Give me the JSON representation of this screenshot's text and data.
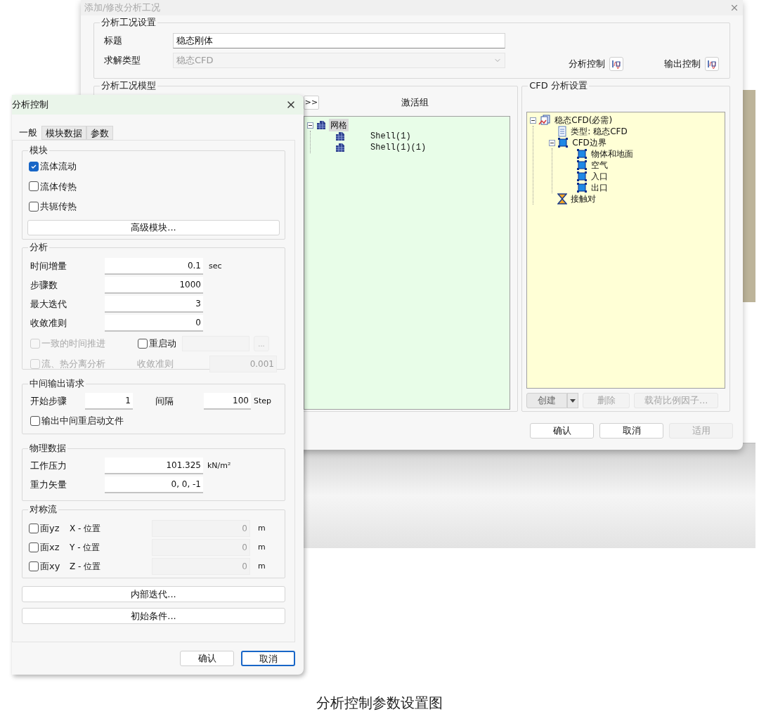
{
  "main_window": {
    "title": "添加/修改分析工况",
    "case_settings": {
      "legend": "分析工况设置",
      "title_field": {
        "label": "标题",
        "value": "稳态刚体"
      },
      "solver_field": {
        "label": "求解类型",
        "value": "稳态CFD",
        "disabled": true
      },
      "controls": [
        "分析控制",
        "输出控制"
      ]
    },
    "case_model": {
      "legend": "分析工况模型",
      "expand_button": ">>",
      "header": "激活组",
      "tree": [
        {
          "label": "网格",
          "kind": "mesh",
          "expanded": true,
          "selected": true,
          "children": [
            {
              "label": "Shell(1)",
              "kind": "mesh",
              "selected": false
            },
            {
              "label": "Shell(1)(1)",
              "kind": "mesh",
              "selected": false
            }
          ]
        }
      ]
    },
    "cfd_settings": {
      "legend": "CFD 分析设置",
      "tree": [
        {
          "label": "稳态CFD(必需)",
          "kind": "analysis",
          "expanded": true,
          "selected": false,
          "children": [
            {
              "label": "类型: 稳态CFD",
              "kind": "document",
              "selected": false
            },
            {
              "label": "CFD边界",
              "kind": "boundary",
              "expanded": true,
              "selected": false,
              "children": [
                {
                  "label": "物体和地面",
                  "kind": "boundary",
                  "selected": false
                },
                {
                  "label": "空气",
                  "kind": "boundary",
                  "selected": false
                },
                {
                  "label": "入口",
                  "kind": "boundary",
                  "selected": false
                },
                {
                  "label": "出口",
                  "kind": "boundary",
                  "selected": false
                }
              ]
            },
            {
              "label": "接触对",
              "kind": "contact",
              "selected": false
            }
          ]
        }
      ],
      "buttons": [
        {
          "label": "创建",
          "kind": "split",
          "disabled": false
        },
        {
          "label": "删除",
          "kind": "plain",
          "disabled": true
        },
        {
          "label": "载荷比例因子...",
          "kind": "plain",
          "disabled": true
        }
      ]
    },
    "buttons": [
      {
        "label": "确认",
        "disabled": false
      },
      {
        "label": "取消",
        "disabled": false
      },
      {
        "label": "适用",
        "disabled": true
      }
    ]
  },
  "dialog": {
    "title": "分析控制",
    "tabs": [
      {
        "label": "一般",
        "selected": true
      },
      {
        "label": "模块数据",
        "selected": false
      },
      {
        "label": "参数",
        "selected": false
      }
    ],
    "module": {
      "legend": "模块",
      "options": [
        {
          "label": "流体流动",
          "checked": true
        },
        {
          "label": "流体传热",
          "checked": false
        },
        {
          "label": "共轭传热",
          "checked": false
        }
      ],
      "button": "高级模块..."
    },
    "analysis": {
      "legend": "分析",
      "fields": [
        {
          "label": "时间增量",
          "value": "0.1",
          "unit": "sec"
        },
        {
          "label": "步骤数",
          "value": "1000"
        },
        {
          "label": "最大迭代",
          "value": "3"
        },
        {
          "label": "收敛准则",
          "value": "0"
        }
      ],
      "uniform_time": {
        "label": "一致的时间推进",
        "checked": false,
        "disabled": true
      },
      "restart": {
        "label": "重启动",
        "checked": false,
        "disabled": false
      },
      "browse_button": {
        "label": "...",
        "disabled": true
      },
      "separate": {
        "label": "流、热分离分析",
        "checked": false,
        "disabled": true
      },
      "separate_criterion": {
        "label": "收敛准则",
        "value": "0.001",
        "disabled": true
      }
    },
    "output": {
      "legend": "中间输出请求",
      "start": {
        "label": "开始步骤",
        "value": "1"
      },
      "interval": {
        "label": "间隔",
        "value": "100",
        "unit": "Step"
      },
      "restart_file": {
        "label": "输出中间重启动文件",
        "checked": false
      }
    },
    "physical": {
      "legend": "物理数据",
      "fields": [
        {
          "label": "工作压力",
          "value": "101.325",
          "unit": "kN/m²"
        },
        {
          "label": "重力矢量",
          "value": "0, 0, -1"
        }
      ]
    },
    "symmetry": {
      "legend": "对称流",
      "planes": [
        {
          "label": "面yz",
          "checked": false,
          "axis": "X - 位置",
          "value": "0",
          "unit": "m",
          "disabled": true
        },
        {
          "label": "面xz",
          "checked": false,
          "axis": "Y - 位置",
          "value": "0",
          "unit": "m",
          "disabled": true
        },
        {
          "label": "面xy",
          "checked": false,
          "axis": "Z - 位置",
          "value": "0",
          "unit": "m",
          "disabled": true
        }
      ]
    },
    "buttons": [
      "内部迭代...",
      "初始条件..."
    ],
    "footer": [
      {
        "label": "确认",
        "default": false
      },
      {
        "label": "取消",
        "default": true
      }
    ]
  },
  "caption": "分析控制参数设置图"
}
